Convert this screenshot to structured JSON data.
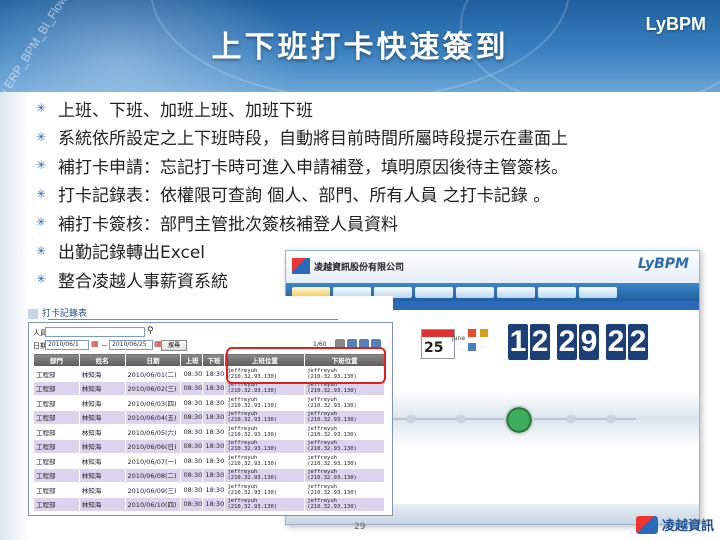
{
  "slide": {
    "title": "上下班打卡快速簽到",
    "brand": "LyBPM",
    "watermark": "Flow ERP_BPM_BI_Flow_",
    "page_number": "29",
    "footer_brand": "凌越資訊"
  },
  "bullets": [
    "上班、下班、加班上班、加班下班",
    "系統依所設定之上下班時段，自動將目前時間所屬時段提示在畫面上",
    "補打卡申請：忘記打卡時可進入申請補登，填明原因後待主管簽核。",
    "打卡記錄表：依權限可查詢 個人、部門、所有人員 之打卡記錄 。",
    "補打卡簽核：部門主管批次簽核補登人員資料",
    "出勤記錄轉出Excel",
    "整合凌越人事薪資系統"
  ],
  "portal": {
    "company": "凌越資訊股份有限公司",
    "brand": "LyBPM",
    "calendar_day": "25",
    "calendar_month": "June",
    "clock_digits": [
      "1",
      "2",
      "2",
      "9",
      "2",
      "2"
    ]
  },
  "report": {
    "title": "打卡記錄表",
    "person_label": "人員",
    "date_label": "日期",
    "date_from": "2010/06/1",
    "date_sep": "－",
    "date_to": "2010/06/25",
    "query_button": "搜尋",
    "page_indicator": "1/60",
    "columns": [
      "部門",
      "姓名",
      "日期",
      "上班",
      "下班",
      "上班位置",
      "下班位置"
    ],
    "rows": [
      {
        "dept": "工程部",
        "name": "林知海",
        "date": "2010/06/01(二)",
        "in": "08:30",
        "out": "18:30",
        "in_loc_1": "jeffreyuh",
        "in_loc_2": "(210.32.93.130)",
        "out_loc_1": "jeffreyuh",
        "out_loc_2": "(210.32.93.130)"
      },
      {
        "dept": "工程部",
        "name": "林知海",
        "date": "2010/06/02(三)",
        "in": "08:30",
        "out": "18:30",
        "in_loc_1": "jeffreyuh",
        "in_loc_2": "(210.32.93.130)",
        "out_loc_1": "jeffreyuh",
        "out_loc_2": "(210.32.93.130)"
      },
      {
        "dept": "工程部",
        "name": "林知海",
        "date": "2010/06/03(四)",
        "in": "08:30",
        "out": "18:30",
        "in_loc_1": "jeffreyuh",
        "in_loc_2": "(210.32.93.130)",
        "out_loc_1": "jeffreyuh",
        "out_loc_2": "(210.32.93.130)"
      },
      {
        "dept": "工程部",
        "name": "林知海",
        "date": "2010/06/04(五)",
        "in": "08:30",
        "out": "18:30",
        "in_loc_1": "jeffreyuh",
        "in_loc_2": "(210.32.93.130)",
        "out_loc_1": "jeffreyuh",
        "out_loc_2": "(210.32.93.130)"
      },
      {
        "dept": "工程部",
        "name": "林知海",
        "date": "2010/06/05(六)",
        "in": "08:30",
        "out": "18:30",
        "in_loc_1": "jeffreyuh",
        "in_loc_2": "(210.32.93.130)",
        "out_loc_1": "jeffreyuh",
        "out_loc_2": "(210.32.93.130)"
      },
      {
        "dept": "工程部",
        "name": "林知海",
        "date": "2010/06/06(日)",
        "in": "08:30",
        "out": "18:30",
        "in_loc_1": "jeffreyuh",
        "in_loc_2": "(210.32.93.130)",
        "out_loc_1": "jeffreyuh",
        "out_loc_2": "(210.32.93.130)"
      },
      {
        "dept": "工程部",
        "name": "林知海",
        "date": "2010/06/07(一)",
        "in": "08:30",
        "out": "18:30",
        "in_loc_1": "jeffreyuh",
        "in_loc_2": "(210.32.93.130)",
        "out_loc_1": "jeffreyuh",
        "out_loc_2": "(210.32.93.130)"
      },
      {
        "dept": "工程部",
        "name": "林知海",
        "date": "2010/06/08(二)",
        "in": "08:30",
        "out": "18:30",
        "in_loc_1": "jeffreyuh",
        "in_loc_2": "(210.32.93.130)",
        "out_loc_1": "jeffreyuh",
        "out_loc_2": "(210.32.93.130)"
      },
      {
        "dept": "工程部",
        "name": "林知海",
        "date": "2010/06/09(三)",
        "in": "08:30",
        "out": "18:30",
        "in_loc_1": "jeffreyuh",
        "in_loc_2": "(210.32.93.130)",
        "out_loc_1": "jeffreyuh",
        "out_loc_2": "(210.32.93.130)"
      },
      {
        "dept": "工程部",
        "name": "林知海",
        "date": "2010/06/10(四)",
        "in": "08:30",
        "out": "18:30",
        "in_loc_1": "jeffreyuh",
        "in_loc_2": "(210.32.93.130)",
        "out_loc_1": "jeffreyuh",
        "out_loc_2": "(210.32.93.130)"
      }
    ]
  },
  "colors": {
    "banner": "#2a6ab8",
    "highlight": "#e02020",
    "row_alt": "#dcd4ee"
  }
}
